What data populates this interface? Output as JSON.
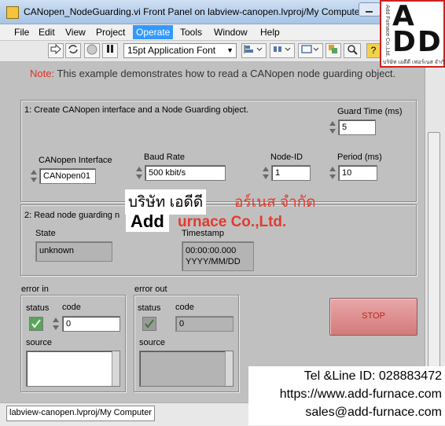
{
  "window": {
    "title": "CANopen_NodeGuarding.vi Front Panel on labview-canopen.lvproj/My Computer"
  },
  "menu": {
    "items": [
      "File",
      "Edit",
      "View",
      "Project",
      "Operate",
      "Tools",
      "Window",
      "Help"
    ],
    "active": "Operate"
  },
  "toolbar": {
    "font": "15pt Application Font",
    "icons": [
      "run-arrow-icon",
      "run-continuously-icon",
      "abort-icon",
      "pause-icon",
      "align-icon",
      "distribute-icon",
      "resize-icon",
      "reorder-icon",
      "search-icon",
      "help-icon"
    ]
  },
  "note": {
    "prefix": "Note:",
    "text": " This example demonstrates how to read a CANopen node guarding object."
  },
  "section1": {
    "title": "1: Create CANopen interface and a Node Guarding object.",
    "guard_time": {
      "label": "Guard Time (ms)",
      "value": "5"
    },
    "interface": {
      "label": "CANopen Interface",
      "value": "CANopen01"
    },
    "baud_rate": {
      "label": "Baud Rate",
      "value": "500 kbit/s"
    },
    "node_id": {
      "label": "Node-ID",
      "value": "1"
    },
    "period": {
      "label": "Period (ms)",
      "value": "10"
    }
  },
  "section2": {
    "title": "2: Read node guarding n",
    "state": {
      "label": "State",
      "value": "unknown"
    },
    "timestamp": {
      "label": "Timestamp",
      "value": "00:00:00.000\nYYYY/MM/DD"
    }
  },
  "error_in": {
    "title": "error in",
    "status_label": "status",
    "code_label": "code",
    "code_value": "0",
    "source_label": "source",
    "status": true
  },
  "error_out": {
    "title": "error out",
    "status_label": "status",
    "code_label": "code",
    "code_value": "0",
    "source_label": "source",
    "status": true
  },
  "stop_button": {
    "label": "STOP"
  },
  "status_bar": {
    "path": "labview-canopen.lvproj/My Computer"
  },
  "watermark": {
    "logo_letters": "ADD",
    "logo_vertical": "Add Furnace Co.,Ltd.",
    "logo_thai": "บริษัท เอดีดี เฟอร์เนส จำกัด",
    "thai_name_part1": "บริษัท เอดีดี",
    "thai_name_part2": "อร์เนส จำกัด",
    "add": "Add",
    "company": "urnace Co.,Ltd.",
    "tel": "Tel &Line ID: 028883472",
    "url": "https://www.add-furnace.com",
    "email": "sales@add-furnace.com"
  },
  "colors": {
    "panel": "#c0c0c0",
    "note_highlight": "#e0301e",
    "stop_button": "#d47a7a",
    "watermark_red": "#e23b2e"
  }
}
